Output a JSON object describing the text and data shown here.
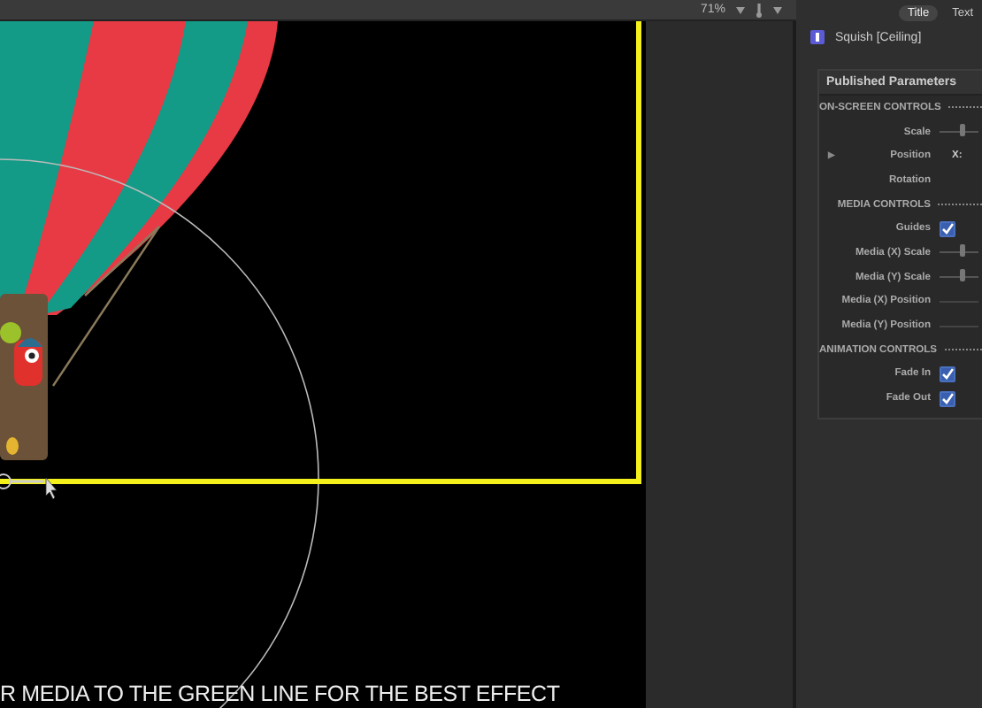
{
  "toolbar": {
    "zoom": "71%"
  },
  "canvas": {
    "caption": "R MEDIA TO THE GREEN LINE FOR THE BEST EFFECT"
  },
  "inspector": {
    "tabs": [
      {
        "label": "Title",
        "selected": true
      },
      {
        "label": "Text",
        "selected": false
      }
    ],
    "effect": "Squish [Ceiling]",
    "panel_title": "Published Parameters",
    "parameters": [
      {
        "kind": "section",
        "label": "ON-SCREEN CONTROLS"
      },
      {
        "kind": "slider",
        "label": "Scale",
        "level": 0.6
      },
      {
        "kind": "position",
        "label": "Position",
        "toggle": "▶",
        "axis": "X:"
      },
      {
        "kind": "plain",
        "label": "Rotation"
      },
      {
        "kind": "section",
        "label": "MEDIA CONTROLS"
      },
      {
        "kind": "checkbox",
        "label": "Guides",
        "checked": true
      },
      {
        "kind": "slider",
        "label": "Media (X) Scale",
        "level": 0.6
      },
      {
        "kind": "slider",
        "label": "Media (Y) Scale",
        "level": 0.6
      },
      {
        "kind": "track",
        "label": "Media (X) Position"
      },
      {
        "kind": "track",
        "label": "Media (Y) Position"
      },
      {
        "kind": "section",
        "label": "ANIMATION CONTROLS"
      },
      {
        "kind": "checkbox",
        "label": "Fade In",
        "checked": true
      },
      {
        "kind": "checkbox",
        "label": "Fade Out",
        "checked": true
      }
    ]
  }
}
